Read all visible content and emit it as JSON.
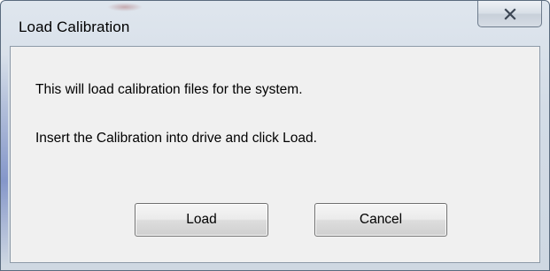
{
  "window": {
    "title": "Load Calibration",
    "close_icon": "close-icon"
  },
  "message": {
    "line1": "This will load calibration files for the system.",
    "line2": "Insert the Calibration into drive and click Load."
  },
  "buttons": {
    "load_label": "Load",
    "cancel_label": "Cancel"
  },
  "colors": {
    "frame": "#d3dce6",
    "client_background": "#f0f0f0",
    "button_border": "#707070"
  }
}
